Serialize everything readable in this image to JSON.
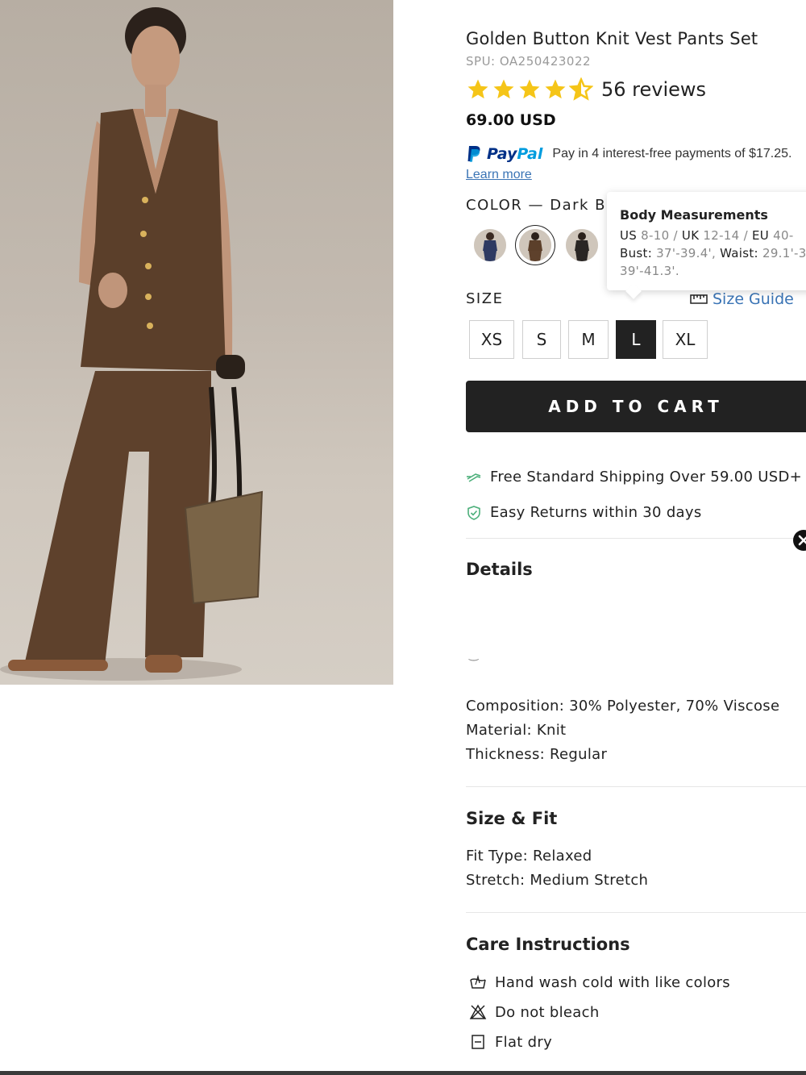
{
  "product": {
    "title": "Golden Button Knit Vest Pants Set",
    "spu": "SPU: OA250423022",
    "rating": 4.5,
    "reviews": "56 reviews",
    "price": "69.00 USD"
  },
  "paypal": {
    "logo_p": "Pay",
    "logo_pal": "Pal",
    "text": "Pay in 4 interest-free payments of $17.25.",
    "learn_more": "Learn more"
  },
  "color": {
    "label": "COLOR — Dark Bro",
    "swatches": [
      "navy-set",
      "dark-brown-set",
      "black-set"
    ],
    "selected": "dark-brown-set"
  },
  "tooltip": {
    "heading": "Body Measurements",
    "line1_a": "US",
    "line1_b": " 8-10 / ",
    "line1_c": "UK",
    "line1_d": " 12-14 / ",
    "line1_e": "EU",
    "line1_f": " 40-",
    "line2_a": "Bust:",
    "line2_b": " 37'-39.4', ",
    "line2_c": "Waist:",
    "line2_d": " 29.1'-3",
    "line3": "39'-41.3'."
  },
  "size": {
    "label": "SIZE",
    "guide": "Size Guide",
    "options": [
      "XS",
      "S",
      "M",
      "L",
      "XL"
    ],
    "selected": "L"
  },
  "cart": {
    "label": "ADD TO CART"
  },
  "perks": {
    "shipping": "Free Standard Shipping Over 59.00 USD+",
    "returns": "Easy Returns within 30 days"
  },
  "details": {
    "heading": "Details",
    "stray": "‿",
    "composition": "Composition: 30% Polyester, 70% Viscose",
    "material": "Material: Knit",
    "thickness": "Thickness: Regular"
  },
  "size_fit": {
    "heading": "Size & Fit",
    "fit_type": "Fit Type: Relaxed",
    "stretch": "Stretch: Medium Stretch"
  },
  "care": {
    "heading": "Care Instructions",
    "items": [
      "Hand wash cold with like colors",
      "Do not bleach",
      "Flat dry"
    ]
  },
  "colors": {
    "brand_dark": "#222222",
    "link_blue": "#3a74b5",
    "star_yellow": "#f5c518",
    "perk_green": "#4caf7a"
  }
}
